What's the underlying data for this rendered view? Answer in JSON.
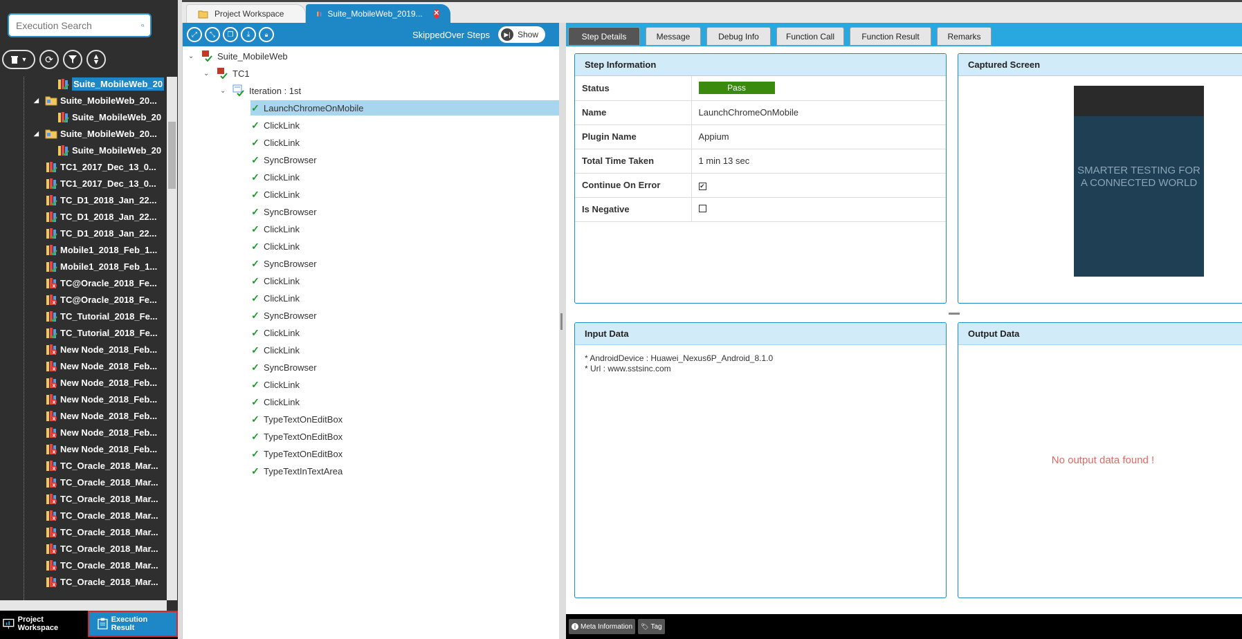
{
  "search": {
    "placeholder": "Execution Search"
  },
  "left_tree": [
    {
      "label": "Suite_MobileWeb_20",
      "level": 3,
      "selected": true,
      "icon": "suite-icon"
    },
    {
      "label": "Suite_MobileWeb_20...",
      "level": 2,
      "icon": "folder-icon",
      "expand": "◢"
    },
    {
      "label": "Suite_MobileWeb_20",
      "level": 3,
      "icon": "suite-icon"
    },
    {
      "label": "Suite_MobileWeb_20...",
      "level": 2,
      "icon": "folder-icon",
      "expand": "◢"
    },
    {
      "label": "Suite_MobileWeb_20",
      "level": 3,
      "icon": "suite-icon"
    },
    {
      "label": "TC1_2017_Dec_13_0...",
      "level": 2,
      "icon": "testcase-icon"
    },
    {
      "label": "TC1_2017_Dec_13_0...",
      "level": 2,
      "icon": "testcase-icon"
    },
    {
      "label": "TC_D1_2018_Jan_22...",
      "level": 2,
      "icon": "testcase-icon"
    },
    {
      "label": "TC_D1_2018_Jan_22...",
      "level": 2,
      "icon": "testcase-icon"
    },
    {
      "label": "TC_D1_2018_Jan_22...",
      "level": 2,
      "icon": "testcase-icon"
    },
    {
      "label": "Mobile1_2018_Feb_1...",
      "level": 2,
      "icon": "testcase-icon"
    },
    {
      "label": "Mobile1_2018_Feb_1...",
      "level": 2,
      "icon": "testcase-icon"
    },
    {
      "label": "TC@Oracle_2018_Fe...",
      "level": 2,
      "icon": "testcase-fail-icon"
    },
    {
      "label": "TC@Oracle_2018_Fe...",
      "level": 2,
      "icon": "testcase-fail-icon"
    },
    {
      "label": "TC_Tutorial_2018_Fe...",
      "level": 2,
      "icon": "testcase-icon"
    },
    {
      "label": "TC_Tutorial_2018_Fe...",
      "level": 2,
      "icon": "testcase-icon"
    },
    {
      "label": "New Node_2018_Feb...",
      "level": 2,
      "icon": "testcase-fail-icon"
    },
    {
      "label": "New Node_2018_Feb...",
      "level": 2,
      "icon": "testcase-fail-icon"
    },
    {
      "label": "New Node_2018_Feb...",
      "level": 2,
      "icon": "testcase-fail-icon"
    },
    {
      "label": "New Node_2018_Feb...",
      "level": 2,
      "icon": "testcase-fail-icon"
    },
    {
      "label": "New Node_2018_Feb...",
      "level": 2,
      "icon": "testcase-fail-icon"
    },
    {
      "label": "New Node_2018_Feb...",
      "level": 2,
      "icon": "testcase-fail-icon"
    },
    {
      "label": "New Node_2018_Feb...",
      "level": 2,
      "icon": "testcase-fail-icon"
    },
    {
      "label": "TC_Oracle_2018_Mar...",
      "level": 2,
      "icon": "testcase-fail-icon"
    },
    {
      "label": "TC_Oracle_2018_Mar...",
      "level": 2,
      "icon": "testcase-fail-icon"
    },
    {
      "label": "TC_Oracle_2018_Mar...",
      "level": 2,
      "icon": "testcase-fail-icon"
    },
    {
      "label": "TC_Oracle_2018_Mar...",
      "level": 2,
      "icon": "testcase-fail-icon"
    },
    {
      "label": "TC_Oracle_2018_Mar...",
      "level": 2,
      "icon": "testcase-fail-icon"
    },
    {
      "label": "TC_Oracle_2018_Mar...",
      "level": 2,
      "icon": "testcase-fail-icon"
    },
    {
      "label": "TC_Oracle_2018_Mar...",
      "level": 2,
      "icon": "testcase-fail-icon"
    },
    {
      "label": "TC_Oracle_2018_Mar...",
      "level": 2,
      "icon": "testcase-fail-icon"
    }
  ],
  "bottom_tabs": {
    "workspace": "Project Workspace",
    "execution": "Execution Result"
  },
  "top_tabs": {
    "workspace": "Project Workspace",
    "suite": "Suite_MobileWeb_2019..."
  },
  "step_toolbar": {
    "skipped_label": "SkippedOver Steps",
    "show_label": "Show"
  },
  "step_tree": [
    {
      "label": "Suite_MobileWeb",
      "level": 0,
      "icon": "suite-root-icon",
      "expand": "⌄"
    },
    {
      "label": "TC1",
      "level": 1,
      "icon": "tc-icon",
      "expand": "⌄"
    },
    {
      "label": "Iteration : 1st",
      "level": 2,
      "icon": "iteration-icon",
      "expand": "⌄"
    },
    {
      "label": "LaunchChromeOnMobile",
      "level": 3,
      "selected": true
    },
    {
      "label": "ClickLink",
      "level": 3
    },
    {
      "label": "ClickLink",
      "level": 3
    },
    {
      "label": "SyncBrowser",
      "level": 3
    },
    {
      "label": "ClickLink",
      "level": 3
    },
    {
      "label": "ClickLink",
      "level": 3
    },
    {
      "label": "SyncBrowser",
      "level": 3
    },
    {
      "label": "ClickLink",
      "level": 3
    },
    {
      "label": "ClickLink",
      "level": 3
    },
    {
      "label": "SyncBrowser",
      "level": 3
    },
    {
      "label": "ClickLink",
      "level": 3
    },
    {
      "label": "ClickLink",
      "level": 3
    },
    {
      "label": "SyncBrowser",
      "level": 3
    },
    {
      "label": "ClickLink",
      "level": 3
    },
    {
      "label": "ClickLink",
      "level": 3
    },
    {
      "label": "SyncBrowser",
      "level": 3
    },
    {
      "label": "ClickLink",
      "level": 3
    },
    {
      "label": "ClickLink",
      "level": 3
    },
    {
      "label": "TypeTextOnEditBox",
      "level": 3
    },
    {
      "label": "TypeTextOnEditBox",
      "level": 3
    },
    {
      "label": "TypeTextOnEditBox",
      "level": 3
    },
    {
      "label": "TypeTextInTextArea",
      "level": 3
    }
  ],
  "detail_tabs": [
    {
      "label": "Step Details",
      "active": true
    },
    {
      "label": "Message"
    },
    {
      "label": "Debug Info"
    },
    {
      "label": "Function Call"
    },
    {
      "label": "Function Result"
    },
    {
      "label": "Remarks"
    }
  ],
  "step_info": {
    "title": "Step Information",
    "rows": [
      {
        "key": "Status",
        "value": "Pass",
        "type": "badge"
      },
      {
        "key": "Name",
        "value": "LaunchChromeOnMobile"
      },
      {
        "key": "Plugin Name",
        "value": "Appium"
      },
      {
        "key": "Total Time Taken",
        "value": "1 min 13 sec"
      },
      {
        "key": "Continue On Error",
        "value": "✔",
        "type": "checkbox"
      },
      {
        "key": "Is Negative",
        "value": "",
        "type": "checkbox"
      }
    ]
  },
  "captured": {
    "title": "Captured Screen",
    "phone_text": "SMARTER TESTING FOR A CONNECTED WORLD"
  },
  "input_data": {
    "title": "Input Data",
    "lines": [
      "* AndroidDevice : Huawei_Nexus6P_Android_8.1.0",
      "* Url : www.sstsinc.com"
    ]
  },
  "output_data": {
    "title": "Output Data",
    "empty_message": "No output data found !"
  },
  "meta_bar": {
    "meta": "Meta Information",
    "tag": "Tag"
  },
  "colors": {
    "accent": "#1e88c7",
    "pass": "#3a8a0e",
    "error_text": "#e06a60"
  }
}
